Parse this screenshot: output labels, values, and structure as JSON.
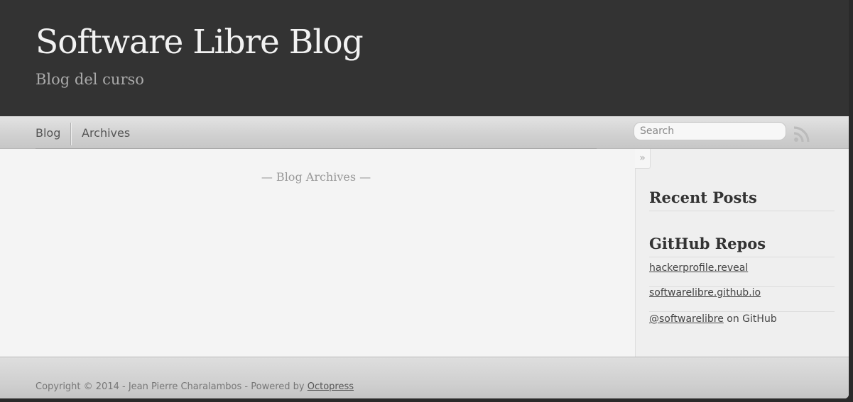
{
  "header": {
    "title": "Software Libre Blog",
    "subtitle": "Blog del curso"
  },
  "nav": {
    "links": [
      {
        "label": "Blog"
      },
      {
        "label": "Archives"
      }
    ],
    "search": {
      "placeholder": "Search",
      "value": ""
    },
    "rss_icon": "rss-icon"
  },
  "main": {
    "archives_heading": "— Blog Archives —"
  },
  "sidebar": {
    "collapse_glyph": "»",
    "recent_posts_title": "Recent Posts",
    "github_title": "GitHub Repos",
    "repos": [
      {
        "name": "hackerprofile.reveal"
      },
      {
        "name": "softwarelibre.github.io"
      }
    ],
    "profile": {
      "handle": "@softwarelibre",
      "suffix": " on GitHub"
    }
  },
  "footer": {
    "copyright": "Copyright © 2014 - Jean Pierre Charalambos - Powered by ",
    "powered_link": "Octopress"
  },
  "colors": {
    "header_bg": "#333333",
    "title": "#f2f2f2",
    "subtitle": "#aaaaaa",
    "rss": "#bbbbbb"
  }
}
